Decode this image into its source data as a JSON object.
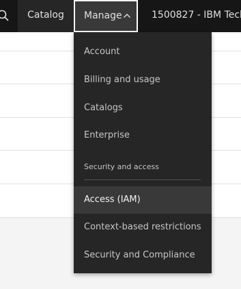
{
  "header": {
    "search_icon": "search-icon",
    "catalog_label": "Catalog",
    "manage_label": "Manage",
    "manage_chevron_icon": "chevron-up-icon",
    "account_label": "1500827 - IBM Tech"
  },
  "manage_menu": {
    "items": [
      {
        "label": "Account"
      },
      {
        "label": "Billing and usage"
      },
      {
        "label": "Catalogs"
      },
      {
        "label": "Enterprise"
      }
    ],
    "section_title": "Security and access",
    "security_items": [
      {
        "label": "Access (IAM)",
        "highlighted": true
      },
      {
        "label": "Context-based restrictions"
      },
      {
        "label": "Security and Compliance"
      }
    ]
  },
  "colors": {
    "header_bg": "#161616",
    "menu_bg": "#262626",
    "menu_highlight": "#393939",
    "menu_text": "#c6c6c6"
  }
}
